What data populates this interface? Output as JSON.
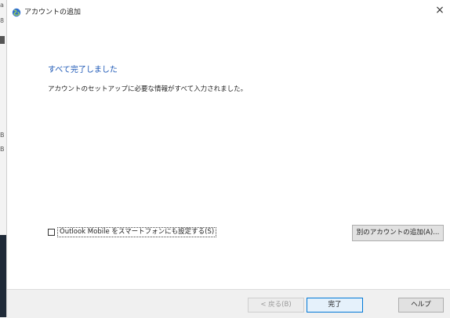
{
  "window": {
    "title": "アカウントの追加",
    "close_glyph": "×",
    "icon": "outlook-globe-icon"
  },
  "background_window": {
    "marks": [
      "a",
      "8",
      "B",
      "B"
    ]
  },
  "content": {
    "heading": "すべて完了しました",
    "description": "アカウントのセットアップに必要な情報がすべて入力されました。"
  },
  "options": {
    "outlook_mobile_label": "Outlook Mobile をスマートフォンにも設定する(S)",
    "outlook_mobile_checked": false,
    "add_another_account_label": "別のアカウントの追加(A)..."
  },
  "footer": {
    "back_label": "< 戻る(B)",
    "finish_label": "完了",
    "help_label": "ヘルプ"
  },
  "colors": {
    "heading": "#1a56b5",
    "default_button_border": "#0078d7"
  }
}
